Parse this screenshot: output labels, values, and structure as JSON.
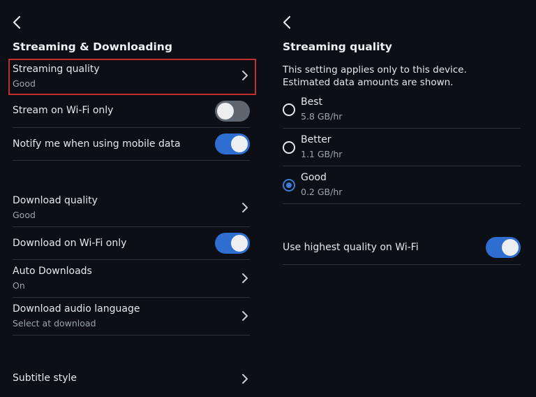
{
  "left": {
    "title": "Streaming & Downloading",
    "streaming_quality": {
      "label": "Streaming quality",
      "value": "Good"
    },
    "stream_wifi_only": {
      "label": "Stream on Wi-Fi only",
      "enabled": false
    },
    "notify_mobile_data": {
      "label": "Notify me when using mobile data",
      "enabled": true
    },
    "download_quality": {
      "label": "Download quality",
      "value": "Good"
    },
    "download_wifi_only": {
      "label": "Download on Wi-Fi only",
      "enabled": true
    },
    "auto_downloads": {
      "label": "Auto Downloads",
      "value": "On"
    },
    "download_audio_language": {
      "label": "Download audio language",
      "value": "Select at download"
    },
    "subtitle_style": {
      "label": "Subtitle style"
    }
  },
  "right": {
    "title": "Streaming quality",
    "description_line1": "This setting applies only to this device.",
    "description_line2": "Estimated data amounts are shown.",
    "options": [
      {
        "label": "Best",
        "data": "5.8 GB/hr",
        "selected": false
      },
      {
        "label": "Better",
        "data": "1.1 GB/hr",
        "selected": false
      },
      {
        "label": "Good",
        "data": "0.2 GB/hr",
        "selected": true
      }
    ],
    "highest_quality_wifi": {
      "label": "Use highest quality on Wi-Fi",
      "enabled": true
    }
  },
  "colors": {
    "background": "#0c1016",
    "accent": "#2f6ed1",
    "highlight_border": "#c0302c",
    "toggle_off": "#5f6670"
  },
  "icons": {
    "back": "chevron-left-icon",
    "row_chevron": "chevron-right-icon"
  }
}
